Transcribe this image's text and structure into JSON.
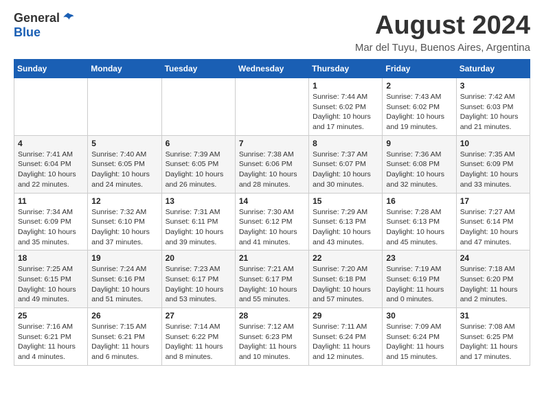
{
  "logo": {
    "general": "General",
    "blue": "Blue"
  },
  "title": {
    "month_year": "August 2024",
    "location": "Mar del Tuyu, Buenos Aires, Argentina"
  },
  "weekdays": [
    "Sunday",
    "Monday",
    "Tuesday",
    "Wednesday",
    "Thursday",
    "Friday",
    "Saturday"
  ],
  "weeks": [
    [
      {
        "day": "",
        "info": ""
      },
      {
        "day": "",
        "info": ""
      },
      {
        "day": "",
        "info": ""
      },
      {
        "day": "",
        "info": ""
      },
      {
        "day": "1",
        "info": "Sunrise: 7:44 AM\nSunset: 6:02 PM\nDaylight: 10 hours\nand 17 minutes."
      },
      {
        "day": "2",
        "info": "Sunrise: 7:43 AM\nSunset: 6:02 PM\nDaylight: 10 hours\nand 19 minutes."
      },
      {
        "day": "3",
        "info": "Sunrise: 7:42 AM\nSunset: 6:03 PM\nDaylight: 10 hours\nand 21 minutes."
      }
    ],
    [
      {
        "day": "4",
        "info": "Sunrise: 7:41 AM\nSunset: 6:04 PM\nDaylight: 10 hours\nand 22 minutes."
      },
      {
        "day": "5",
        "info": "Sunrise: 7:40 AM\nSunset: 6:05 PM\nDaylight: 10 hours\nand 24 minutes."
      },
      {
        "day": "6",
        "info": "Sunrise: 7:39 AM\nSunset: 6:05 PM\nDaylight: 10 hours\nand 26 minutes."
      },
      {
        "day": "7",
        "info": "Sunrise: 7:38 AM\nSunset: 6:06 PM\nDaylight: 10 hours\nand 28 minutes."
      },
      {
        "day": "8",
        "info": "Sunrise: 7:37 AM\nSunset: 6:07 PM\nDaylight: 10 hours\nand 30 minutes."
      },
      {
        "day": "9",
        "info": "Sunrise: 7:36 AM\nSunset: 6:08 PM\nDaylight: 10 hours\nand 32 minutes."
      },
      {
        "day": "10",
        "info": "Sunrise: 7:35 AM\nSunset: 6:09 PM\nDaylight: 10 hours\nand 33 minutes."
      }
    ],
    [
      {
        "day": "11",
        "info": "Sunrise: 7:34 AM\nSunset: 6:09 PM\nDaylight: 10 hours\nand 35 minutes."
      },
      {
        "day": "12",
        "info": "Sunrise: 7:32 AM\nSunset: 6:10 PM\nDaylight: 10 hours\nand 37 minutes."
      },
      {
        "day": "13",
        "info": "Sunrise: 7:31 AM\nSunset: 6:11 PM\nDaylight: 10 hours\nand 39 minutes."
      },
      {
        "day": "14",
        "info": "Sunrise: 7:30 AM\nSunset: 6:12 PM\nDaylight: 10 hours\nand 41 minutes."
      },
      {
        "day": "15",
        "info": "Sunrise: 7:29 AM\nSunset: 6:13 PM\nDaylight: 10 hours\nand 43 minutes."
      },
      {
        "day": "16",
        "info": "Sunrise: 7:28 AM\nSunset: 6:13 PM\nDaylight: 10 hours\nand 45 minutes."
      },
      {
        "day": "17",
        "info": "Sunrise: 7:27 AM\nSunset: 6:14 PM\nDaylight: 10 hours\nand 47 minutes."
      }
    ],
    [
      {
        "day": "18",
        "info": "Sunrise: 7:25 AM\nSunset: 6:15 PM\nDaylight: 10 hours\nand 49 minutes."
      },
      {
        "day": "19",
        "info": "Sunrise: 7:24 AM\nSunset: 6:16 PM\nDaylight: 10 hours\nand 51 minutes."
      },
      {
        "day": "20",
        "info": "Sunrise: 7:23 AM\nSunset: 6:17 PM\nDaylight: 10 hours\nand 53 minutes."
      },
      {
        "day": "21",
        "info": "Sunrise: 7:21 AM\nSunset: 6:17 PM\nDaylight: 10 hours\nand 55 minutes."
      },
      {
        "day": "22",
        "info": "Sunrise: 7:20 AM\nSunset: 6:18 PM\nDaylight: 10 hours\nand 57 minutes."
      },
      {
        "day": "23",
        "info": "Sunrise: 7:19 AM\nSunset: 6:19 PM\nDaylight: 11 hours\nand 0 minutes."
      },
      {
        "day": "24",
        "info": "Sunrise: 7:18 AM\nSunset: 6:20 PM\nDaylight: 11 hours\nand 2 minutes."
      }
    ],
    [
      {
        "day": "25",
        "info": "Sunrise: 7:16 AM\nSunset: 6:21 PM\nDaylight: 11 hours\nand 4 minutes."
      },
      {
        "day": "26",
        "info": "Sunrise: 7:15 AM\nSunset: 6:21 PM\nDaylight: 11 hours\nand 6 minutes."
      },
      {
        "day": "27",
        "info": "Sunrise: 7:14 AM\nSunset: 6:22 PM\nDaylight: 11 hours\nand 8 minutes."
      },
      {
        "day": "28",
        "info": "Sunrise: 7:12 AM\nSunset: 6:23 PM\nDaylight: 11 hours\nand 10 minutes."
      },
      {
        "day": "29",
        "info": "Sunrise: 7:11 AM\nSunset: 6:24 PM\nDaylight: 11 hours\nand 12 minutes."
      },
      {
        "day": "30",
        "info": "Sunrise: 7:09 AM\nSunset: 6:24 PM\nDaylight: 11 hours\nand 15 minutes."
      },
      {
        "day": "31",
        "info": "Sunrise: 7:08 AM\nSunset: 6:25 PM\nDaylight: 11 hours\nand 17 minutes."
      }
    ]
  ]
}
